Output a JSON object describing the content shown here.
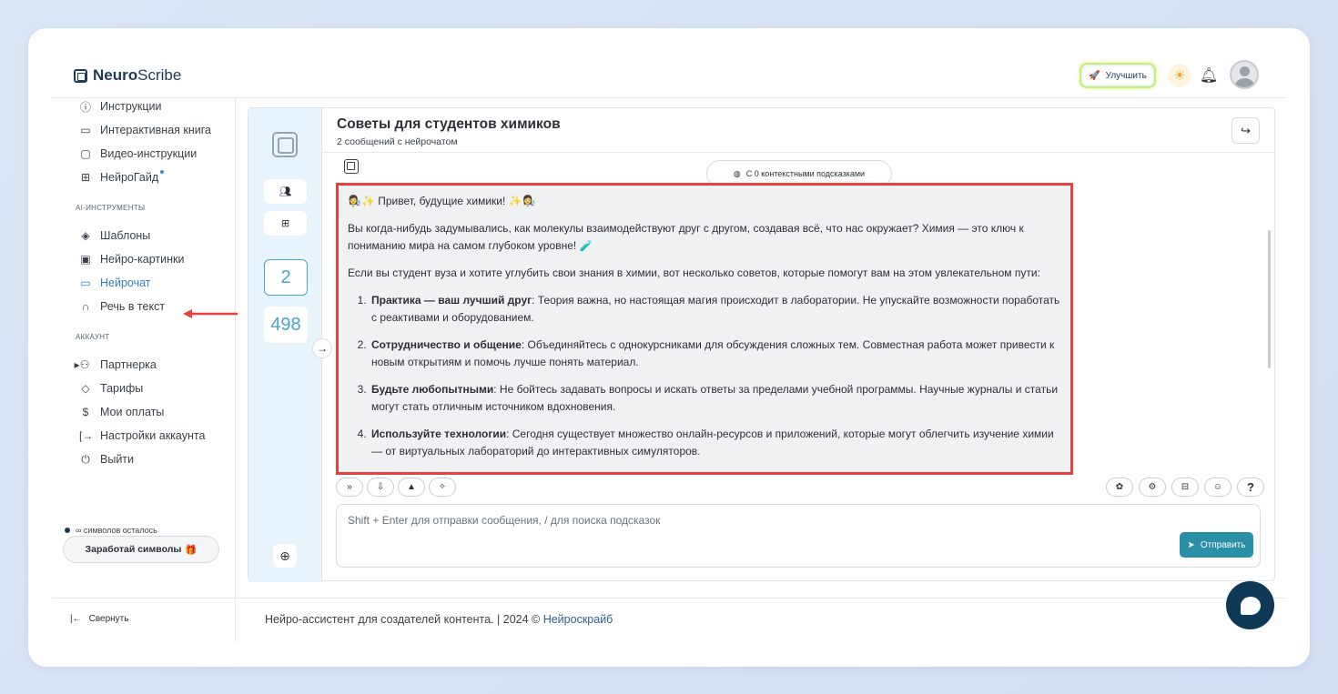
{
  "app": {
    "logo_prefix": "Neuro",
    "logo_suffix": "Scribe"
  },
  "header": {
    "upgrade_label": "Улучшить"
  },
  "sidebar": {
    "items_top": [
      {
        "label": "Инструкции",
        "icon": "help-circle-icon"
      },
      {
        "label": "Интерактивная книга",
        "icon": "book-icon"
      },
      {
        "label": "Видео-инструкции",
        "icon": "video-icon"
      },
      {
        "label": "НейроГайд",
        "icon": "layout-icon"
      }
    ],
    "section_ai": "AI-ИНСТРУМЕНТЫ",
    "items_ai": [
      {
        "label": "Шаблоны",
        "icon": "layers-icon"
      },
      {
        "label": "Нейро-картинки",
        "icon": "image-icon"
      },
      {
        "label": "Нейрочат",
        "icon": "chat-icon"
      },
      {
        "label": "Речь в текст",
        "icon": "headphones-icon"
      }
    ],
    "section_account": "АККАУНТ",
    "items_account": [
      {
        "label": "Партнерка",
        "icon": "users-icon"
      },
      {
        "label": "Тарифы",
        "icon": "tag-icon"
      },
      {
        "label": "Мои оплаты",
        "icon": "dollar-icon"
      },
      {
        "label": "Настройки аккаунта",
        "icon": "login-icon"
      },
      {
        "label": "Выйти",
        "icon": "power-icon"
      }
    ],
    "symbols_left": "∞ символов осталось",
    "symbols_progress": 1.0,
    "earn_label": "Заработай символы"
  },
  "left_column": {
    "count_chats": "2",
    "count_other": "498"
  },
  "chat": {
    "title": "Советы для студентов химиков",
    "subtitle": "2 сообщений с нейрочатом",
    "context_pill": "С 0 контекстными подсказками",
    "message": {
      "greeting": "👩‍🔬✨ Привет, будущие химики! ✨👩‍🔬",
      "p1": "Вы когда-нибудь задумывались, как молекулы взаимодействуют друг с другом, создавая всё, что нас окружает? Химия — это ключ к пониманию мира на самом глубоком уровне! 🧪",
      "p2": "Если вы студент вуза и хотите углубить свои знания в химии, вот несколько советов, которые помогут вам на этом увлекательном пути:",
      "tips": [
        {
          "title": "Практика — ваш лучший друг",
          "text": ": Теория важна, но настоящая магия происходит в лаборатории. Не упускайте возможности поработать с реактивами и оборудованием."
        },
        {
          "title": "Сотрудничество и общение",
          "text": ": Объединяйтесь с однокурсниками для обсуждения сложных тем. Совместная работа может привести к новым открытиям и помочь лучше понять материал."
        },
        {
          "title": "Будьте любопытными",
          "text": ": Не бойтесь задавать вопросы и искать ответы за пределами учебной программы. Научные журналы и статьи могут стать отличным источником вдохновения."
        },
        {
          "title": "Используйте технологии",
          "text": ": Сегодня существует множество онлайн-ресурсов и приложений, которые могут облегчить изучение химии — от виртуальных лабораторий до интерактивных симуляторов."
        }
      ]
    },
    "input_placeholder": "Shift + Enter для отправки сообщения, / для поиска подсказок",
    "send_label": "Отправить",
    "help_label": "?"
  },
  "footer": {
    "text": "Нейро-ассистент для создателей контента.  | 2024 © ",
    "link": "Нейроскрайб",
    "collapse_label": "Свернуть"
  },
  "colors": {
    "accent": "#2a90a8",
    "highlight_border": "#e8413c",
    "active_nav": "#2f7fb8",
    "fab": "#0f3a57"
  }
}
